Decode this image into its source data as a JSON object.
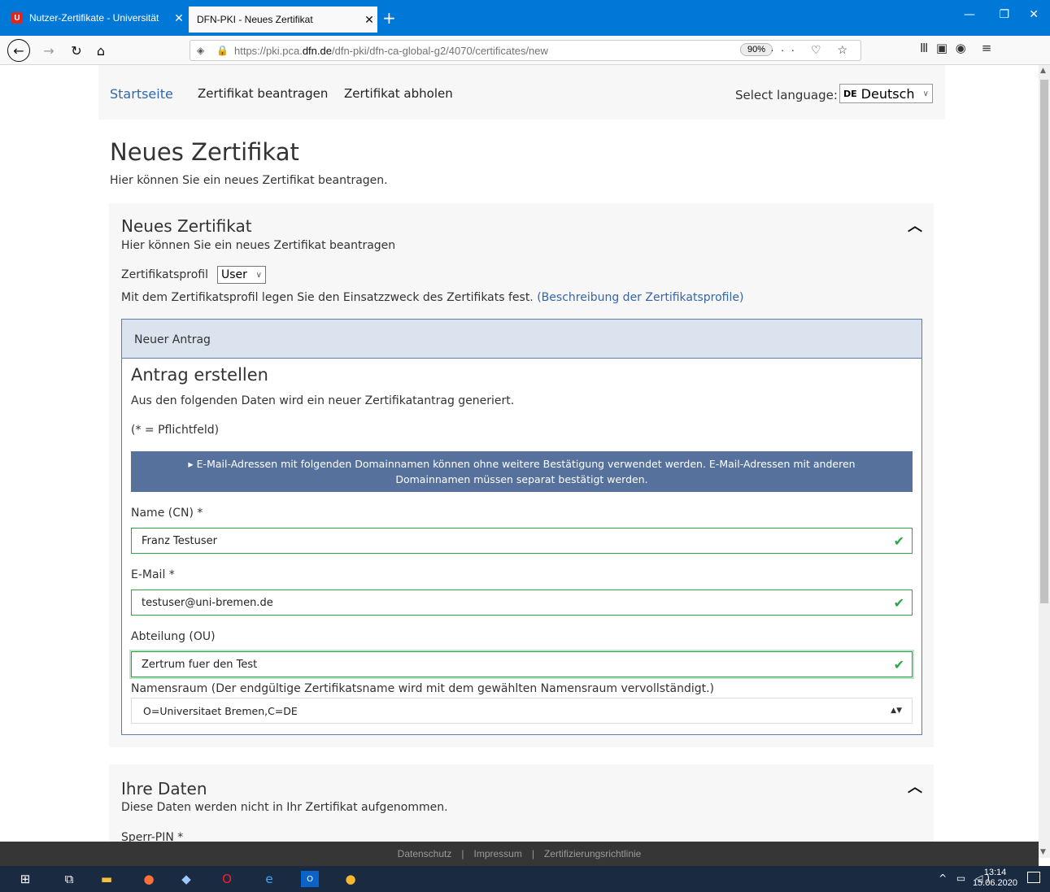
{
  "browser": {
    "tabs": [
      {
        "title": "Nutzer-Zertifikate - Universität",
        "active": false
      },
      {
        "title": "DFN-PKI - Neues Zertifikat",
        "active": true
      }
    ],
    "url_prefix": "https://pki.pca.",
    "url_domain": "dfn.de",
    "url_path": "/dfn-pki/dfn-ca-global-g2/4070/certificates/new",
    "zoom": "90%",
    "tab_close_glyph": "✕",
    "new_tab_glyph": "+"
  },
  "site_nav": {
    "home": "Startseite",
    "request": "Zertifikat beantragen",
    "fetch": "Zertifikat abholen",
    "lang_label": "Select language:",
    "lang_flag": "DE",
    "lang_value": "Deutsch"
  },
  "page": {
    "title": "Neues Zertifikat",
    "lead": "Hier können Sie ein neues Zertifikat beantragen."
  },
  "panel": {
    "title": "Neues Zertifikat",
    "subtitle": "Hier können Sie ein neues Zertifikat beantragen",
    "profile_label": "Zertifikatsprofil",
    "profile_value": "User",
    "profile_desc": "Mit dem Zertifikatsprofil legen Sie den Einsatzzweck des Zertifikats fest.",
    "profile_link": "(Beschreibung der Zertifikatsprofile)"
  },
  "antrag": {
    "header": "Neuer Antrag",
    "title": "Antrag erstellen",
    "subtitle": "Aus den folgenden Daten wird ein neuer Zertifikatantrag generiert.",
    "pflicht": "(* = Pflichtfeld)",
    "info_line1": "▸ E-Mail-Adressen mit folgenden Domainnamen können ohne weitere Bestätigung verwendet werden. E-Mail-Adressen mit anderen",
    "info_line2": "Domainnamen müssen separat bestätigt werden.",
    "fields": {
      "name_label": "Name (CN) *",
      "name_value": "Franz Testuser",
      "email_label": "E-Mail *",
      "email_value": "testuser@uni-bremen.de",
      "ou_label": "Abteilung (OU)",
      "ou_value": "Zertrum fuer den Test",
      "ns_label": "Namensraum (Der endgültige Zertifikatsname wird mit dem gewählten Namensraum vervollständigt.)",
      "ns_value": "O=Universitaet Bremen,C=DE"
    }
  },
  "panel2": {
    "title": "Ihre Daten",
    "subtitle": "Diese Daten werden nicht in Ihr Zertifikat aufgenommen.",
    "pin_label": "Sperr-PIN *"
  },
  "footer": {
    "links": [
      "Datenschutz",
      "Impressum",
      "Zertifizierungsrichtlinie"
    ],
    "separator": "|"
  },
  "taskbar": {
    "time": "13:14",
    "date": "15.06.2020"
  },
  "colors": {
    "browser_blue": "#0078d7",
    "link": "#3366aa",
    "valid_green": "#28a745",
    "info_bar": "#56719c"
  }
}
